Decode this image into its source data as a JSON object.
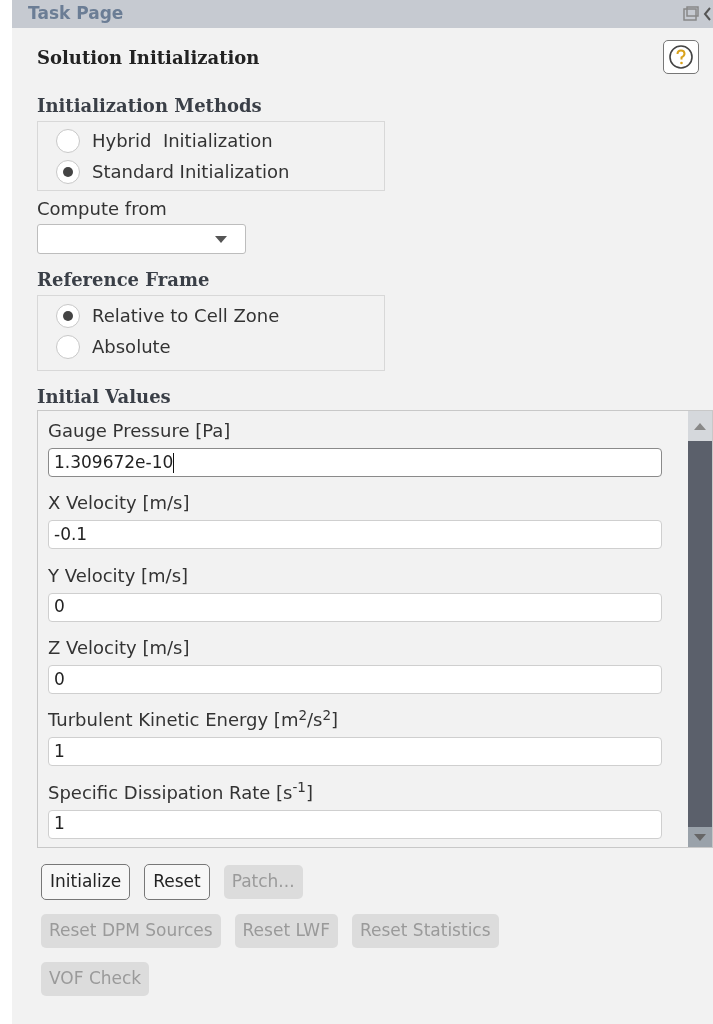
{
  "header": {
    "title": "Task Page"
  },
  "panel": {
    "title": "Solution Initialization"
  },
  "methods": {
    "label": "Initialization Methods",
    "options": [
      {
        "label": "Hybrid  Initialization",
        "selected": false
      },
      {
        "label": "Standard Initialization",
        "selected": true
      }
    ]
  },
  "compute_from": {
    "label": "Compute from"
  },
  "reference_frame": {
    "label": "Reference Frame",
    "options": [
      {
        "label": "Relative to Cell Zone",
        "selected": true
      },
      {
        "label": "Absolute",
        "selected": false
      }
    ]
  },
  "initial_values": {
    "label": "Initial Values",
    "fields": [
      {
        "label": "Gauge Pressure [Pa]",
        "value": "1.309672e-10",
        "focused": true
      },
      {
        "label": "X Velocity [m/s]",
        "value": "-0.1",
        "focused": false
      },
      {
        "label": "Y Velocity [m/s]",
        "value": "0",
        "focused": false
      },
      {
        "label": "Z Velocity [m/s]",
        "value": "0",
        "focused": false
      },
      {
        "label": "Turbulent Kinetic Energy [m$^{2}$/s$^{2}$]",
        "value": "1",
        "focused": false
      },
      {
        "label": "Specific Dissipation Rate [s$^{-1}$]",
        "value": "1",
        "focused": false
      }
    ]
  },
  "button_rows": [
    [
      {
        "label": "Initialize",
        "disabled": false
      },
      {
        "label": "Reset",
        "disabled": false
      },
      {
        "label": "Patch...",
        "disabled": true
      }
    ],
    [
      {
        "label": "Reset DPM Sources",
        "disabled": true
      },
      {
        "label": "Reset LWF",
        "disabled": true
      },
      {
        "label": "Reset Statistics",
        "disabled": true
      }
    ],
    [
      {
        "label": "VOF Check",
        "disabled": true
      }
    ]
  ]
}
